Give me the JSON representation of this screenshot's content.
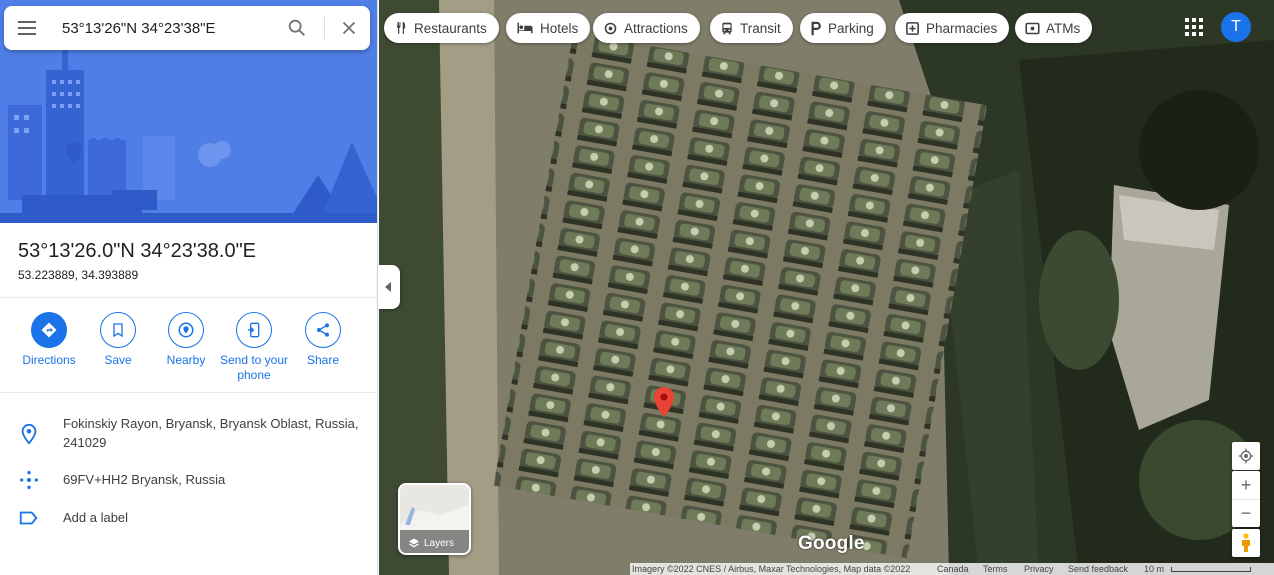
{
  "search": {
    "value": "53°13'26\"N 34°23'38\"E",
    "menu_icon": "hamburger-menu-icon",
    "search_icon": "magnifier-icon",
    "clear_icon": "close-icon"
  },
  "place": {
    "title": "53°13'26.0\"N 34°23'38.0\"E",
    "decimal": "53.223889, 34.393889"
  },
  "actions": [
    {
      "label": "Directions",
      "icon": "directions-icon"
    },
    {
      "label": "Save",
      "icon": "bookmark-icon"
    },
    {
      "label": "Nearby",
      "icon": "nearby-icon"
    },
    {
      "label": "Send to your phone",
      "icon": "send-to-phone-icon"
    },
    {
      "label": "Share",
      "icon": "share-icon"
    }
  ],
  "details": [
    {
      "text": "Fokinskiy Rayon, Bryansk, Bryansk Oblast, Russia, 241029",
      "icon": "location-pin-icon"
    },
    {
      "text": "69FV+HH2 Bryansk, Russia",
      "icon": "plus-code-icon"
    },
    {
      "text": "Add a label",
      "icon": "label-icon"
    }
  ],
  "categories": [
    {
      "label": "Restaurants",
      "icon": "fork-knife-icon"
    },
    {
      "label": "Hotels",
      "icon": "bed-icon"
    },
    {
      "label": "Attractions",
      "icon": "camera-icon"
    },
    {
      "label": "Transit",
      "icon": "bus-icon"
    },
    {
      "label": "Parking",
      "icon": "parking-p-icon"
    },
    {
      "label": "Pharmacies",
      "icon": "pharmacy-icon"
    },
    {
      "label": "ATMs",
      "icon": "atm-icon"
    }
  ],
  "account": {
    "initial": "T",
    "color": "#1a73e8"
  },
  "map": {
    "layers_label": "Layers",
    "logo": "Google",
    "footer": {
      "imagery": "Imagery ©2022 CNES / Airbus, Maxar Technologies, Map data ©2022",
      "country": "Canada",
      "terms": "Terms",
      "privacy": "Privacy",
      "feedback": "Send feedback",
      "scale": "10 m"
    },
    "zoom_in": "+",
    "zoom_out": "−"
  },
  "colors": {
    "accent": "#1a73e8",
    "hero_bg": "#4f7ee6",
    "pin": "#ea4335"
  }
}
